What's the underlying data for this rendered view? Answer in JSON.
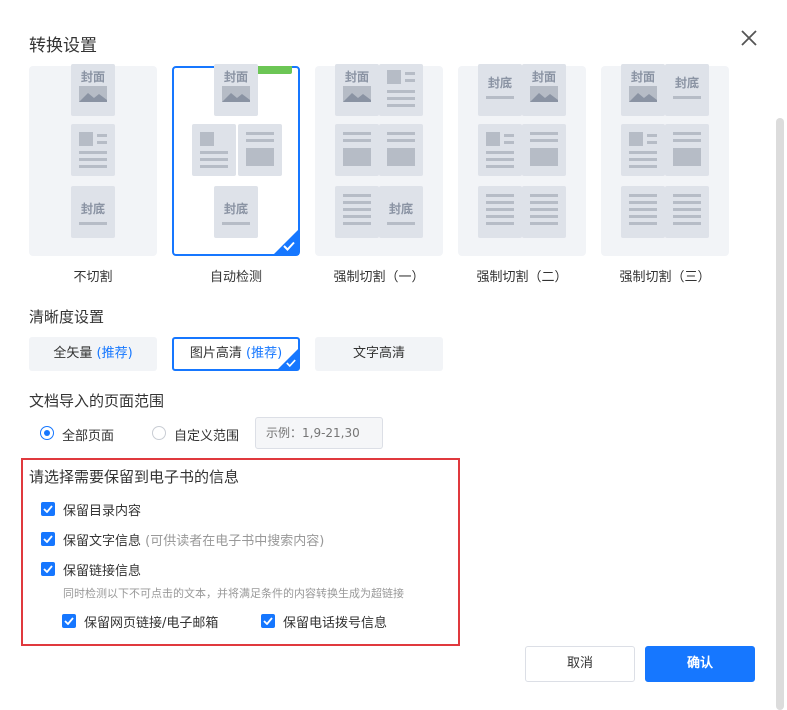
{
  "dialog": {
    "title": "转换设置"
  },
  "layouts": {
    "cover_text": "封面",
    "back_text": "封底",
    "options": [
      {
        "label": "不切割",
        "selected": false
      },
      {
        "label": "自动检测",
        "selected": true
      },
      {
        "label": "强制切割（一）",
        "selected": false
      },
      {
        "label": "强制切割（二）",
        "selected": false
      },
      {
        "label": "强制切割（三）",
        "selected": false
      }
    ]
  },
  "quality": {
    "heading": "清晰度设置",
    "recommended": "(推荐)",
    "options": [
      {
        "label": "全矢量",
        "recommended": true,
        "selected": false
      },
      {
        "label": "图片高清",
        "recommended": true,
        "selected": true
      },
      {
        "label": "文字高清",
        "recommended": false,
        "selected": false
      }
    ]
  },
  "range": {
    "heading": "文档导入的页面范围",
    "all_pages": "全部页面",
    "custom_range": "自定义范围",
    "placeholder": "示例：1,9-21,30",
    "selected": "all_pages"
  },
  "keep": {
    "heading": "请选择需要保留到电子书的信息",
    "toc": "保留目录内容",
    "text": "保留文字信息",
    "text_note": "(可供读者在电子书中搜索内容)",
    "links": "保留链接信息",
    "links_hint": "同时检测以下不可点击的文本，并将满足条件的内容转换生成为超链接",
    "web_email": "保留网页链接/电子邮箱",
    "phone": "保留电话拨号信息"
  },
  "buttons": {
    "cancel": "取消",
    "ok": "确认"
  },
  "colors": {
    "accent": "#1677ff",
    "highlight_border": "#e0393e",
    "tag": "#6cc655"
  }
}
